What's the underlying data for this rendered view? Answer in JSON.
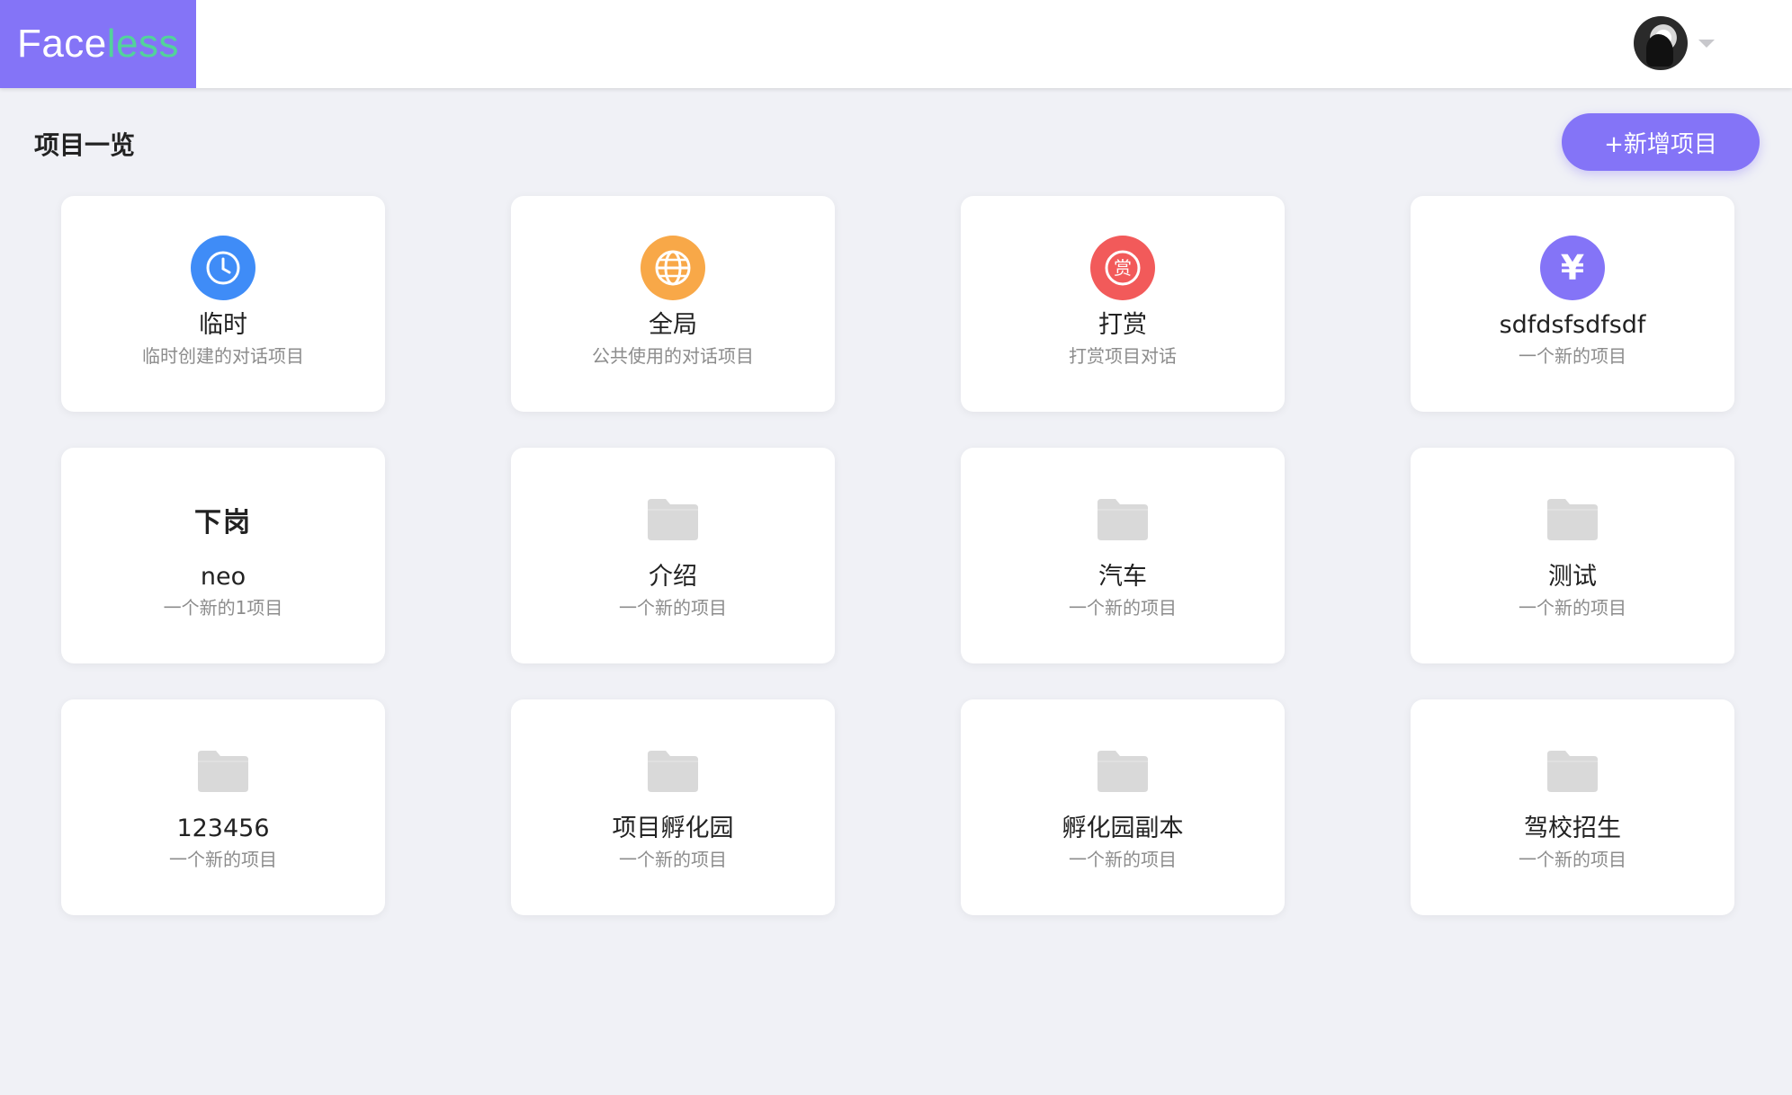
{
  "header": {
    "logo_part1": "Face",
    "logo_part2": "less"
  },
  "main": {
    "title": "项目一览",
    "add_button": "+新增项目"
  },
  "projects": [
    {
      "name": "临时",
      "desc": "临时创建的对话项目",
      "icon": "clock-icon",
      "color": "#3f8cf7"
    },
    {
      "name": "全局",
      "desc": "公共使用的对话项目",
      "icon": "globe-icon",
      "color": "#f8a848"
    },
    {
      "name": "打赏",
      "desc": "打赏项目对话",
      "icon": "reward-icon",
      "color": "#f25a5a"
    },
    {
      "name": "sdfdsfsdfsdf",
      "desc": "一个新的项目",
      "icon": "yen-icon",
      "color": "#8474f7"
    },
    {
      "name": "neo",
      "desc": "一个新的1项目",
      "icon": "xiagang-logo-icon",
      "logo_text": "下岗"
    },
    {
      "name": "介绍",
      "desc": "一个新的项目",
      "icon": "folder-icon"
    },
    {
      "name": "汽车",
      "desc": "一个新的项目",
      "icon": "folder-icon"
    },
    {
      "name": "测试",
      "desc": "一个新的项目",
      "icon": "folder-icon"
    },
    {
      "name": "123456",
      "desc": "一个新的项目",
      "icon": "folder-icon"
    },
    {
      "name": "项目孵化园",
      "desc": "一个新的项目",
      "icon": "folder-icon"
    },
    {
      "name": "孵化园副本",
      "desc": "一个新的项目",
      "icon": "folder-icon"
    },
    {
      "name": "驾校招生",
      "desc": "一个新的项目",
      "icon": "folder-icon"
    }
  ],
  "reward_glyph": "赏",
  "yen_glyph": "¥"
}
